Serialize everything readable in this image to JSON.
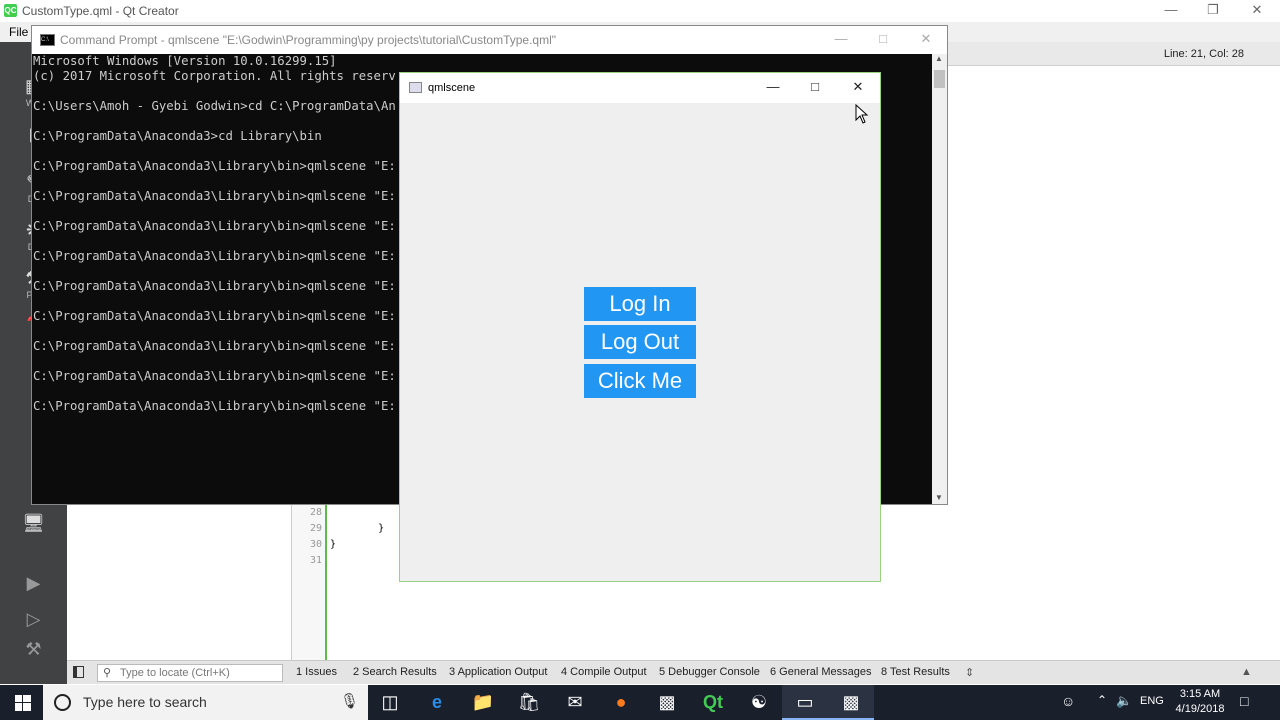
{
  "qtcreator": {
    "title": "CustomType.qml - Qt Creator",
    "logo": "QC",
    "menu_file": "File",
    "cursor_position": "Line: 21, Col: 28",
    "sidebar": [
      "Wel",
      "E",
      "De",
      "De",
      "Pro",
      "H"
    ],
    "line_numbers": [
      "28",
      "29",
      "30",
      "31"
    ],
    "code_lines": [
      "",
      "        }",
      "}",
      ""
    ],
    "locate_placeholder": "Type to locate (Ctrl+K)",
    "output_tabs": [
      "1  Issues",
      "2  Search Results",
      "3  Application Output",
      "4  Compile Output",
      "5  Debugger Console",
      "6  General Messages",
      "8  Test Results"
    ]
  },
  "cmd": {
    "title": "Command Prompt - qmlscene  \"E:\\Godwin\\Programming\\py projects\\tutorial\\CustomType.qml\"",
    "icon_text": "C:\\",
    "lines": [
      "Microsoft Windows [Version 10.0.16299.15]",
      "(c) 2017 Microsoft Corporation. All rights reserv",
      "",
      "C:\\Users\\Amoh - Gyebi Godwin>cd C:\\ProgramData\\An",
      "",
      "C:\\ProgramData\\Anaconda3>cd Library\\bin",
      "",
      "C:\\ProgramData\\Anaconda3\\Library\\bin>qmlscene \"E:",
      "",
      "C:\\ProgramData\\Anaconda3\\Library\\bin>qmlscene \"E:",
      "",
      "C:\\ProgramData\\Anaconda3\\Library\\bin>qmlscene \"E:",
      "",
      "C:\\ProgramData\\Anaconda3\\Library\\bin>qmlscene \"E:",
      "",
      "C:\\ProgramData\\Anaconda3\\Library\\bin>qmlscene \"E:",
      "",
      "C:\\ProgramData\\Anaconda3\\Library\\bin>qmlscene \"E:",
      "",
      "C:\\ProgramData\\Anaconda3\\Library\\bin>qmlscene \"E:",
      "",
      "C:\\ProgramData\\Anaconda3\\Library\\bin>qmlscene \"E:",
      "",
      "C:\\ProgramData\\Anaconda3\\Library\\bin>qmlscene \"E:"
    ]
  },
  "qml": {
    "title": "qmlscene",
    "buttons": [
      "Log In",
      "Log Out",
      "Click Me"
    ],
    "button_color": "#2196f3"
  },
  "taskbar": {
    "search_placeholder": "Type here to search",
    "lang": "ENG",
    "time": "3:15 AM",
    "date": "4/19/2018",
    "icons": [
      "task-view",
      "edge",
      "file-explorer",
      "store",
      "mail",
      "firefox",
      "app",
      "qt-creator",
      "app",
      "cmd",
      "qmlscene"
    ]
  }
}
